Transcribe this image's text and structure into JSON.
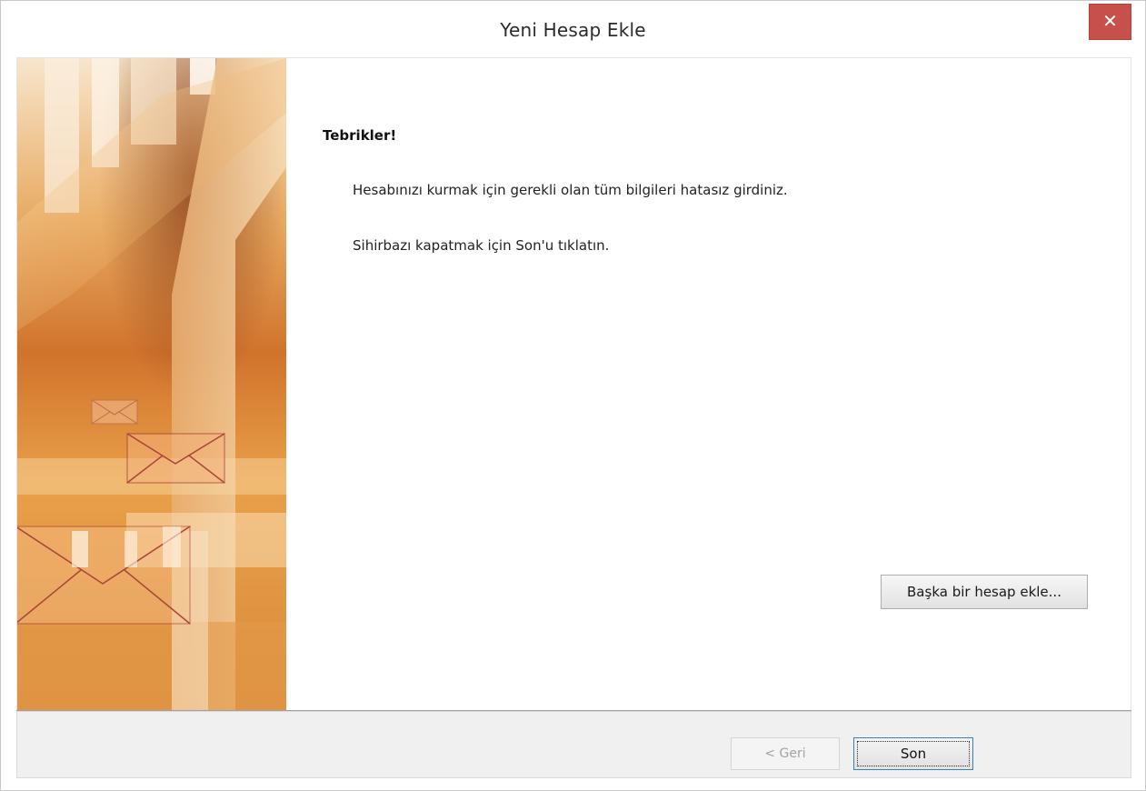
{
  "window": {
    "title": "Yeni Hesap Ekle",
    "close_glyph": "✕"
  },
  "main": {
    "heading": "Tebrikler!",
    "line1": "Hesabınızı kurmak için gerekli olan tüm bilgileri hatasız girdiniz.",
    "line2": "Sihirbazı kapatmak için Son'u tıklatın.",
    "add_account_button": "Başka bir hesap ekle..."
  },
  "footer": {
    "back_button": "< Geri",
    "finish_button": "Son"
  },
  "colors": {
    "close_button": "#c7504b",
    "art_orange": "#d9762b",
    "art_light": "#f6e2bf"
  }
}
